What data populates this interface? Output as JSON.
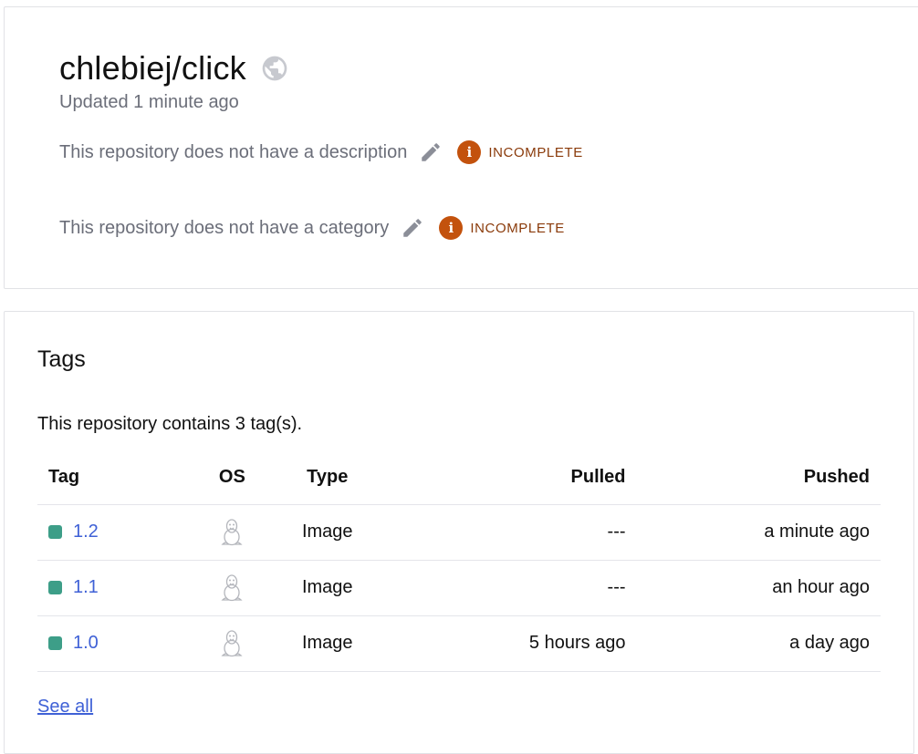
{
  "repo": {
    "title": "chlebiej/click",
    "visibility_icon": "globe-icon",
    "updated": "Updated 1 minute ago",
    "description_text": "This repository does not have a description",
    "category_text": "This repository does not have a category",
    "badge_label": "INCOMPLETE",
    "badge_color": "#c3520d",
    "badge_icon": "info-icon",
    "edit_icon": "pencil-icon"
  },
  "tags": {
    "heading": "Tags",
    "count_text": "This repository contains 3 tag(s).",
    "columns": {
      "tag": "Tag",
      "os": "OS",
      "type": "Type",
      "pulled": "Pulled",
      "pushed": "Pushed"
    },
    "rows": [
      {
        "tag": "1.2",
        "os": "linux-icon",
        "type": "Image",
        "pulled": "---",
        "pushed": "a minute ago"
      },
      {
        "tag": "1.1",
        "os": "linux-icon",
        "type": "Image",
        "pulled": "---",
        "pushed": "an hour ago"
      },
      {
        "tag": "1.0",
        "os": "linux-icon",
        "type": "Image",
        "pulled": "5 hours ago",
        "pushed": "a day ago"
      }
    ],
    "status_color": "#3d9e88",
    "link_color": "#3f61d6",
    "see_all": "See all"
  }
}
